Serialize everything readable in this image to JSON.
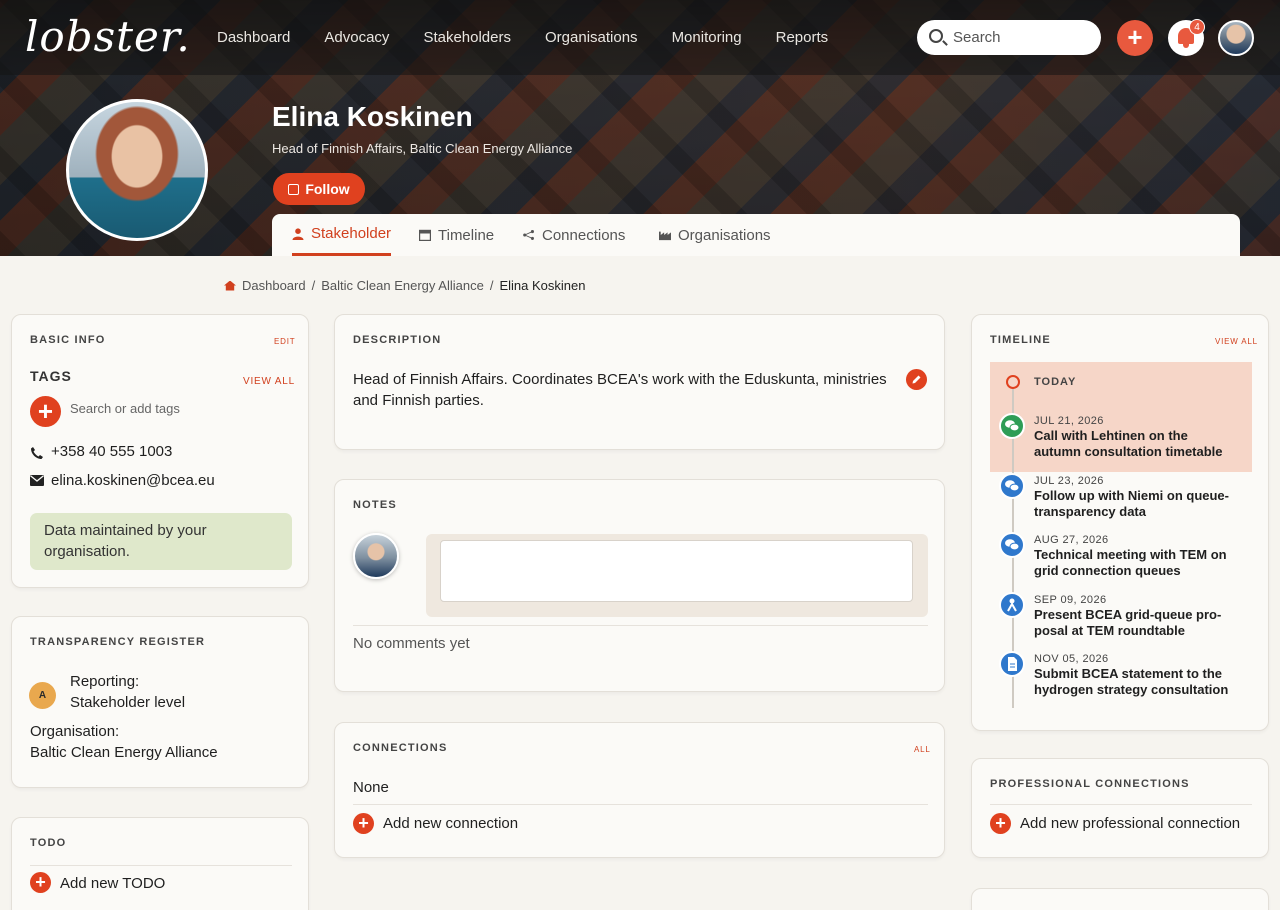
{
  "brand": "lobster.",
  "nav": [
    "Dashboard",
    "Advocacy",
    "Stakeholders",
    "Organisations",
    "Monitoring",
    "Reports"
  ],
  "search": {
    "placeholder": "Search"
  },
  "notifications": {
    "count": "4"
  },
  "profile": {
    "name": "Elina Koskinen",
    "role": "Head of Finnish Affairs, Baltic Clean Energy Alliance",
    "follow_label": "Follow"
  },
  "tabs": [
    {
      "label": "Stakeholder",
      "active": true
    },
    {
      "label": "Timeline"
    },
    {
      "label": "Connections"
    },
    {
      "label": "Organisations"
    }
  ],
  "breadcrumb": [
    "Dashboard",
    "Baltic Clean Energy Alliance",
    "Elina Koskinen"
  ],
  "basic_info": {
    "title": "BASIC INFO",
    "edit_label": "EDIT",
    "tags_title": "TAGS",
    "view_all_label": "VIEW ALL",
    "tags_placeholder": "Search or add tags",
    "phone": "+358 40 555 1003",
    "email": "elina.koskinen@bcea.eu",
    "notice": "Data maintained by your organisation."
  },
  "transparency": {
    "title": "TRANSPARENCY REGISTER",
    "reporting_label": "Reporting:",
    "reporting_value": "Stakeholder level",
    "org_label": "Organisation:",
    "org_value": "Baltic Clean Energy Alliance"
  },
  "todo": {
    "title": "TODO",
    "add_label": "Add new TODO"
  },
  "description": {
    "title": "DESCRIPTION",
    "text": "Head of Finnish Affairs. Coordinates BCEA's work with the Eduskunta, ministries and Finnish parties."
  },
  "notes": {
    "title": "NOTES",
    "empty": "No comments yet"
  },
  "connections": {
    "title": "CONNECTIONS",
    "all_label": "ALL",
    "value": "None",
    "add_label": "Add new connection"
  },
  "timeline": {
    "title": "TIMELINE",
    "view_all_label": "VIEW ALL",
    "today_label": "TODAY",
    "items": [
      {
        "date": "JUL 21, 2026",
        "text": "Call with Lehtinen on the autumn consultation timetable",
        "icon": "chat-icon",
        "color": "#2e9d56"
      },
      {
        "date": "JUL 23, 2026",
        "text": "Follow up with Niemi on queue-transparency data",
        "icon": "chat-icon",
        "color": "#2f78cc"
      },
      {
        "date": "AUG 27, 2026",
        "text": "Technical meeting with TEM on grid connection queues",
        "icon": "chat-icon",
        "color": "#2f78cc"
      },
      {
        "date": "SEP 09, 2026",
        "text": "Present BCEA grid-queue pro-posal at TEM roundtable",
        "icon": "presentation-icon",
        "color": "#2f78cc"
      },
      {
        "date": "NOV 05, 2026",
        "text": "Submit BCEA statement to the hydrogen strategy consultation",
        "icon": "document-icon",
        "color": "#2f78cc"
      }
    ]
  },
  "professional": {
    "title": "PROFESSIONAL CONNECTIONS",
    "add_label": "Add new professional connection"
  },
  "colors": {
    "accent": "#e0411f",
    "highlight": "#f6d6c8",
    "notice_bg": "#dfe8cb"
  }
}
